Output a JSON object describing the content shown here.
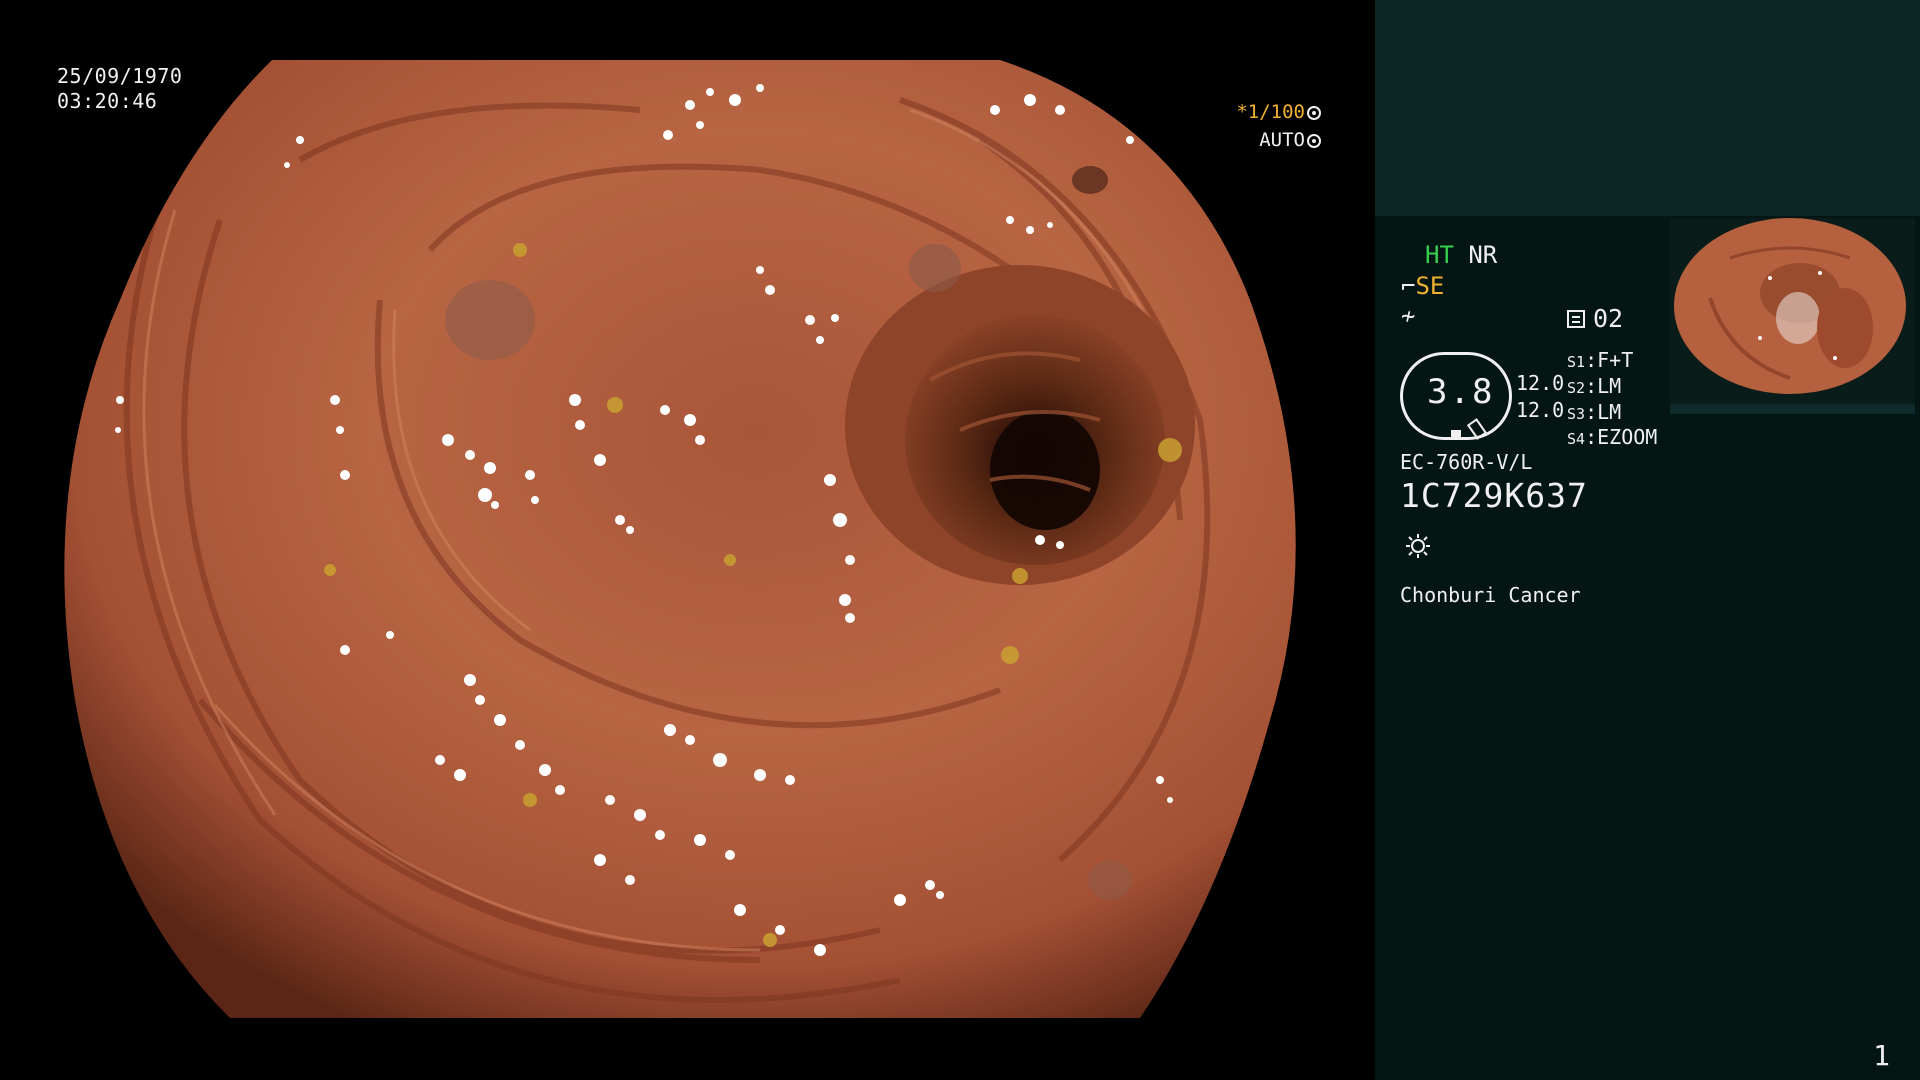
{
  "overlay": {
    "date": "25/09/1970",
    "time": "03:20:46",
    "shutter_speed": "*1/100",
    "exposure_mode": "AUTO"
  },
  "panel": {
    "mode_ht": "HT",
    "mode_nr": "NR",
    "mode_se": "SE",
    "memo_number": "02",
    "zoom_value": "3.8",
    "value_a": "12.0",
    "value_b": "12.0",
    "switches": [
      {
        "label": "S1",
        "value": "F+T"
      },
      {
        "label": "S2",
        "value": "LM"
      },
      {
        "label": "S3",
        "value": "LM"
      },
      {
        "label": "S4",
        "value": "EZOOM"
      }
    ],
    "scope_model": "EC-760R-V/L",
    "serial": "1C729K637",
    "site": "Chonburi Cancer"
  },
  "page_number": "1",
  "colors": {
    "panel_bg": "#041614",
    "panel_top_bg": "#0c2624",
    "accent_green": "#35d050",
    "accent_orange": "#f0b030",
    "tissue": "#b5603f"
  }
}
